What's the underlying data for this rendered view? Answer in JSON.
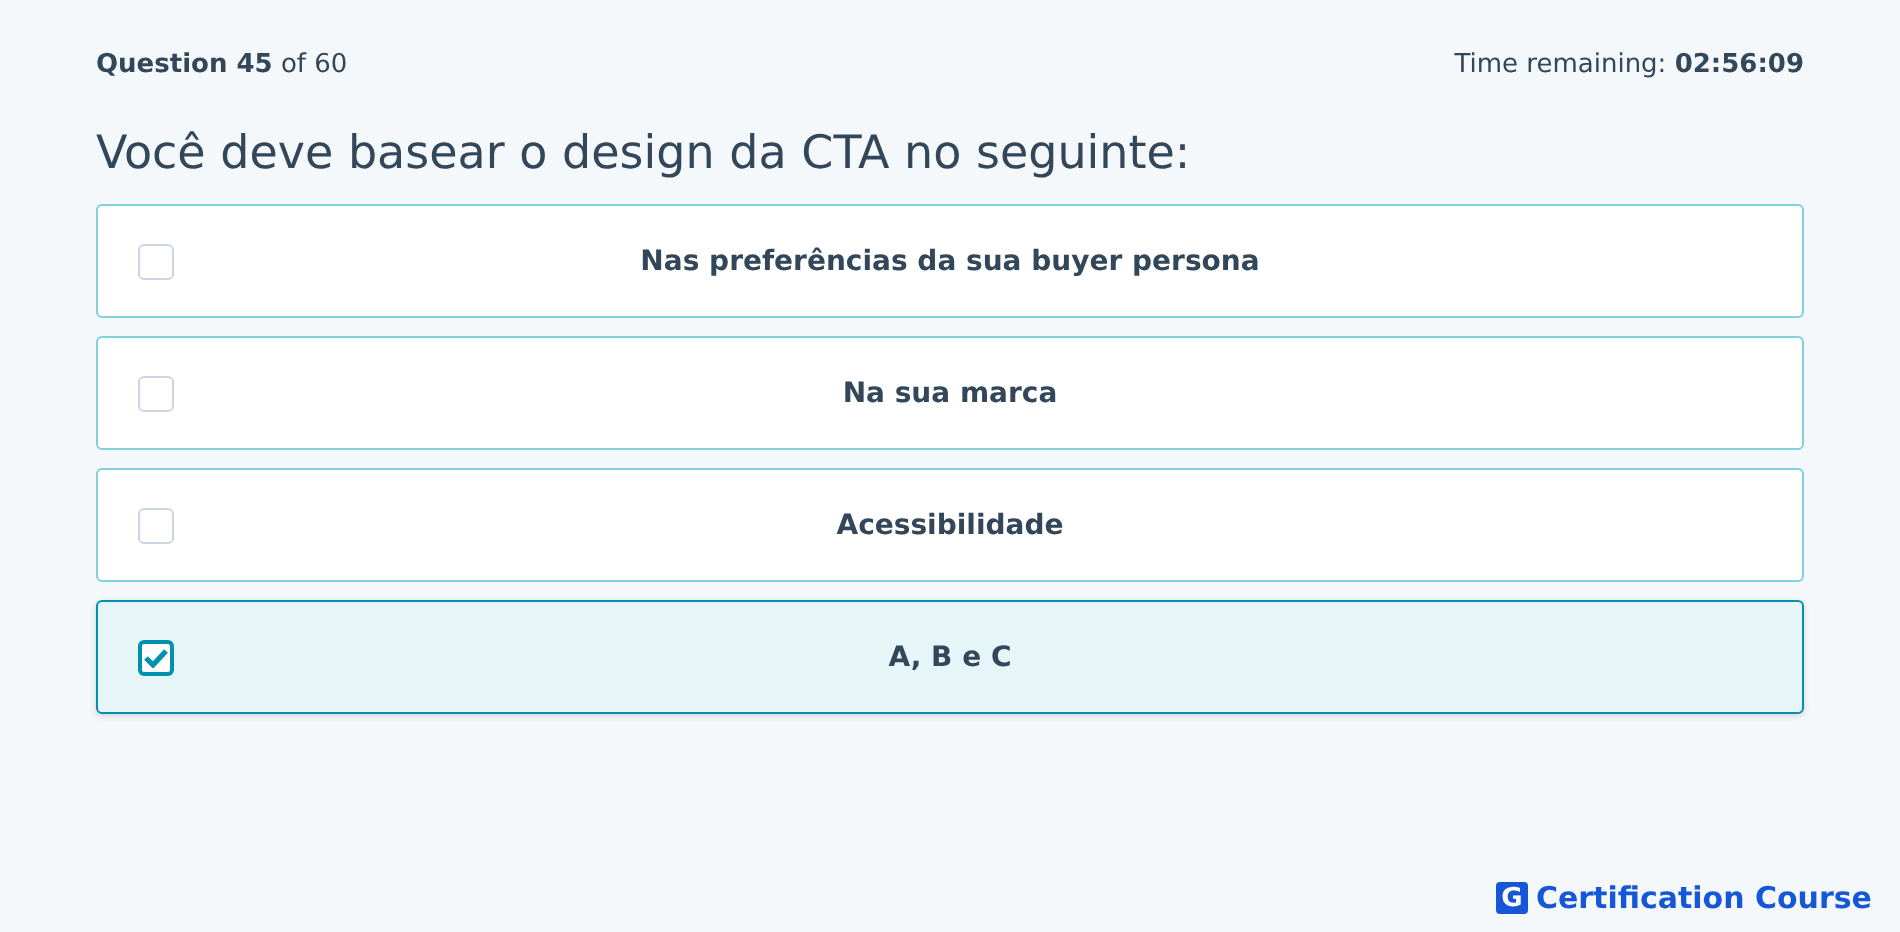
{
  "header": {
    "progress": "**Question 45** of 60",
    "timer": "Time remaining: **02:56:09**"
  },
  "question": "Você deve basear o design da CTA no seguinte:",
  "options": [
    {
      "label": "Nas preferências da sua buyer persona",
      "selected": false
    },
    {
      "label": "Na sua marca",
      "selected": false
    },
    {
      "label": "Acessibilidade",
      "selected": false
    },
    {
      "label": "A, B e C",
      "selected": true
    }
  ],
  "brand": {
    "mark": "G",
    "name": "Certification Course"
  }
}
